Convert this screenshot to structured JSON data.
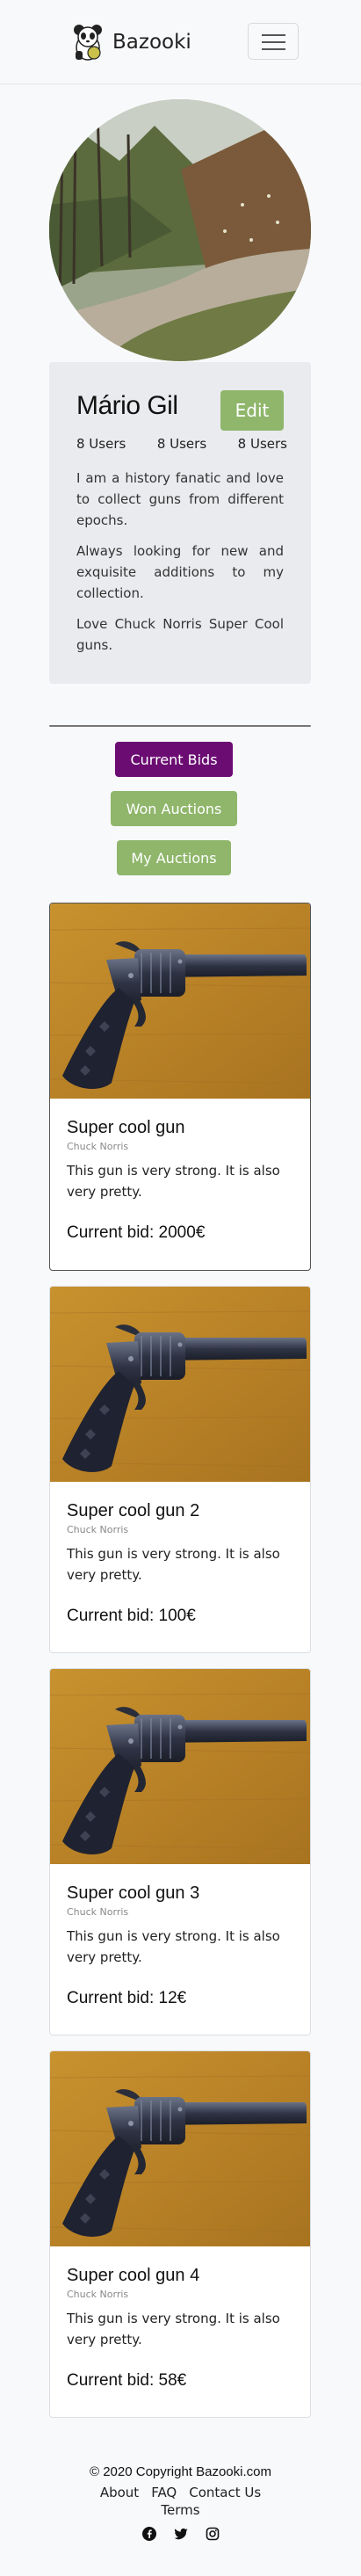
{
  "navbar": {
    "brand": "Bazooki",
    "menu_icon": "hamburger-icon",
    "logo_icon": "panda-logo"
  },
  "profile": {
    "name": "Mário Gil",
    "edit_label": "Edit",
    "stats": [
      "8 Users",
      "8 Users",
      "8 Users"
    ],
    "bio": [
      "I am a history fanatic and love to collect guns from different epochs.",
      "Always looking for new and exquisite additions to my collection.",
      "Love Chuck Norris Super Cool guns."
    ]
  },
  "tabs": {
    "current": "Current Bids",
    "won": "Won Auctions",
    "mine": "My Auctions"
  },
  "colors": {
    "purple": "#6b0c72",
    "green": "#8fb66b"
  },
  "auctions": [
    {
      "title": "Super cool gun",
      "seller": "Chuck Norris",
      "description": "This gun is very strong. It is also very pretty.",
      "bid": "Current bid: 2000€"
    },
    {
      "title": "Super cool gun 2",
      "seller": "Chuck Norris",
      "description": "This gun is very strong. It is also very pretty.",
      "bid": "Current bid: 100€"
    },
    {
      "title": "Super cool gun 3",
      "seller": "Chuck Norris",
      "description": "This gun is very strong. It is also very pretty.",
      "bid": "Current bid: 12€"
    },
    {
      "title": "Super cool gun 4",
      "seller": "Chuck Norris",
      "description": "This gun is very strong. It is also very pretty.",
      "bid": "Current bid: 58€"
    }
  ],
  "footer": {
    "copyright": "© 2020 Copyright Bazooki.com",
    "links": [
      "About",
      "FAQ",
      "Contact Us"
    ],
    "terms": "Terms",
    "social": [
      "facebook-icon",
      "twitter-icon",
      "instagram-icon"
    ]
  }
}
